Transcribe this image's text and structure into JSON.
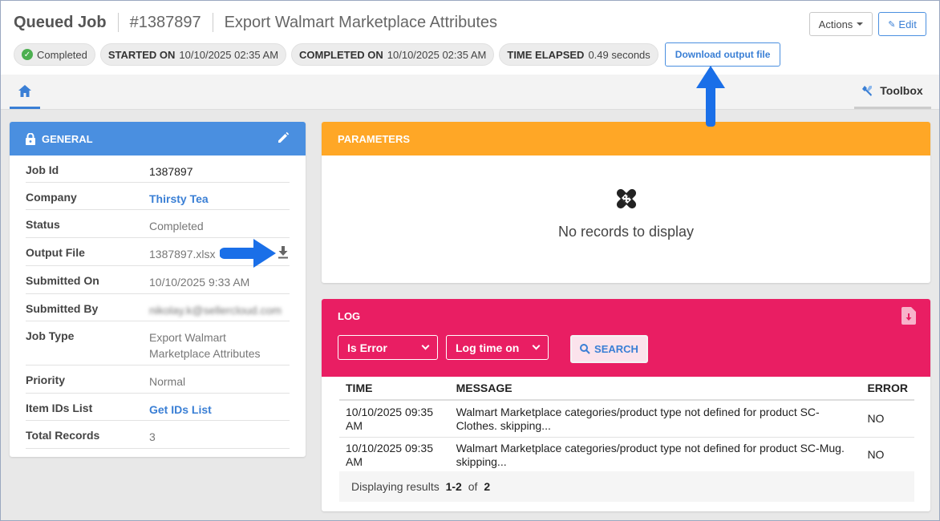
{
  "header": {
    "title": "Queued Job",
    "job_number": "#1387897",
    "job_name": "Export Walmart Marketplace Attributes",
    "actions_label": "Actions",
    "edit_label": "Edit"
  },
  "chips": {
    "status": "Completed",
    "started_label": "STARTED ON",
    "started_value": "10/10/2025 02:35 AM",
    "completed_label": "COMPLETED ON",
    "completed_value": "10/10/2025 02:35 AM",
    "elapsed_label": "TIME ELAPSED",
    "elapsed_value": "0.49 seconds",
    "download_label": "Download output file"
  },
  "tabs": {
    "home": "home",
    "toolbox": "Toolbox"
  },
  "general": {
    "title": "GENERAL",
    "rows": [
      {
        "label": "Job Id",
        "value": "1387897"
      },
      {
        "label": "Company",
        "value": "Thirsty Tea"
      },
      {
        "label": "Status",
        "value": "Completed"
      },
      {
        "label": "Output File",
        "value": "1387897.xlsx"
      },
      {
        "label": "Submitted On",
        "value": "10/10/2025 9:33 AM"
      },
      {
        "label": "Submitted By",
        "value": "nikolay.k@sellercloud.com"
      },
      {
        "label": "Job Type",
        "value": "Export Walmart Marketplace Attributes"
      },
      {
        "label": "Priority",
        "value": "Normal"
      },
      {
        "label": "Item IDs List",
        "value": "Get IDs List"
      },
      {
        "label": "Total Records",
        "value": "3"
      }
    ]
  },
  "parameters": {
    "title": "PARAMETERS",
    "empty_text": "No records to display"
  },
  "log": {
    "title": "LOG",
    "filter_error": "Is Error",
    "filter_time": "Log time on",
    "search_label": "SEARCH",
    "columns": [
      "TIME",
      "MESSAGE",
      "ERROR"
    ],
    "rows": [
      {
        "time": "10/10/2025 09:35 AM",
        "message": "Walmart Marketplace categories/product type not defined for product SC-Clothes. skipping...",
        "error": "NO"
      },
      {
        "time": "10/10/2025 09:35 AM",
        "message": "Walmart Marketplace categories/product type not defined for product SC-Mug. skipping...",
        "error": "NO"
      }
    ],
    "footer_prefix": "Displaying results",
    "footer_range": "1-2",
    "footer_of": "of",
    "footer_total": "2"
  },
  "colors": {
    "accent": "#3a7fd5",
    "general_header": "#4a8fe0",
    "parameters_header": "#ffa726",
    "log_header": "#e91e63",
    "arrow": "#1a6fe8"
  }
}
